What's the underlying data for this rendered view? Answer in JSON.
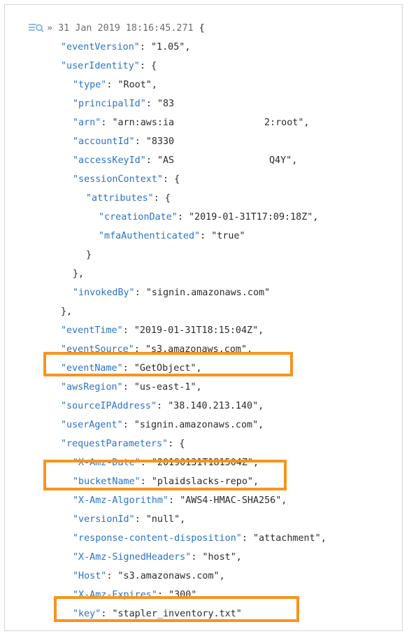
{
  "header": {
    "arrow": "»",
    "timestamp": "31 Jan 2019 18:16:45.271",
    "open_brace": "{"
  },
  "fields": {
    "eventVersion": {
      "k": "\"eventVersion\"",
      "v": "\"1.05\","
    },
    "userIdentity": {
      "k": "\"userIdentity\"",
      "v": "{"
    },
    "type": {
      "k": "\"type\"",
      "v": "\"Root\","
    },
    "principalId": {
      "k": "\"principalId\"",
      "v": "\"83"
    },
    "arn": {
      "k": "\"arn\"",
      "v": "\"arn:aws:ia",
      "v2": "2:root\","
    },
    "accountId": {
      "k": "\"accountId\"",
      "v": "\"8330"
    },
    "accessKeyId": {
      "k": "\"accessKeyId\"",
      "v": "\"AS",
      "v2": "Q4Y\","
    },
    "sessionContext": {
      "k": "\"sessionContext\"",
      "v": "{"
    },
    "attributes": {
      "k": "\"attributes\"",
      "v": "{"
    },
    "creationDate": {
      "k": "\"creationDate\"",
      "v": "\"2019-01-31T17:09:18Z\","
    },
    "mfaAuthenticated": {
      "k": "\"mfaAuthenticated\"",
      "v": "\"true\""
    },
    "close_attr": "}",
    "close_session": "},",
    "invokedBy": {
      "k": "\"invokedBy\"",
      "v": "\"signin.amazonaws.com\""
    },
    "close_identity": "},",
    "eventTime": {
      "k": "\"eventTime\"",
      "v": "\"2019-01-31T18:15:04Z\","
    },
    "eventSource": {
      "k": "\"eventSource\"",
      "v": "\"s3.amazonaws.com\","
    },
    "eventName": {
      "k": "\"eventName\"",
      "v": "\"GetObject\","
    },
    "awsRegion": {
      "k": "\"awsRegion\"",
      "v": "\"us-east-1\","
    },
    "sourceIPAddress": {
      "k": "\"sourceIPAddress\"",
      "v": "\"38.140.213.140\","
    },
    "userAgent": {
      "k": "\"userAgent\"",
      "v": "\"signin.amazonaws.com\","
    },
    "requestParameters": {
      "k": "\"requestParameters\"",
      "v": "{"
    },
    "xAmzDate": {
      "k": "\"X-Amz-Date\"",
      "v": "\"20190131T181504Z\","
    },
    "bucketName": {
      "k": "\"bucketName\"",
      "v": "\"plaidslacks-repo\","
    },
    "xAmzAlgorithm": {
      "k": "\"X-Amz-Algorithm\"",
      "v": "\"AWS4-HMAC-SHA256\","
    },
    "versionId": {
      "k": "\"versionId\"",
      "v": "\"null\","
    },
    "responseContentDisposition": {
      "k": "\"response-content-disposition\"",
      "v": "\"attachment\","
    },
    "xAmzSignedHeaders": {
      "k": "\"X-Amz-SignedHeaders\"",
      "v": "\"host\","
    },
    "host": {
      "k": "\"Host\"",
      "v": "\"s3.amazonaws.com\","
    },
    "xAmzExpires": {
      "k": "\"X-Amz-Expires\"",
      "v": "\"300\","
    },
    "key": {
      "k": "\"key\"",
      "v": "\"stapler_inventory.txt\""
    }
  },
  "highlight_color": "#f7941d",
  "key_color": "#2a73c4"
}
